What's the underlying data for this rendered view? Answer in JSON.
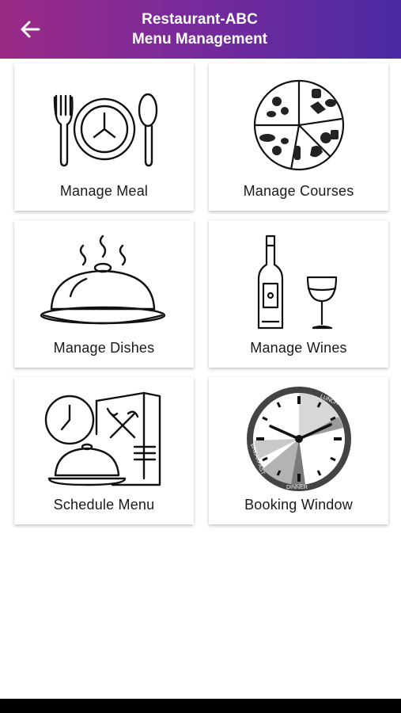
{
  "header": {
    "title_line1": "Restaurant-ABC",
    "title_line2": "Menu Management",
    "back_icon": "arrow-left-icon",
    "gradient_start": "#9b2a86",
    "gradient_end": "#4a2aa4"
  },
  "tiles": [
    {
      "label": "Manage Meal",
      "icon": "meal-plate-icon"
    },
    {
      "label": "Manage Courses",
      "icon": "food-groups-icon"
    },
    {
      "label": "Manage Dishes",
      "icon": "cloche-icon"
    },
    {
      "label": "Manage Wines",
      "icon": "wine-bottle-glass-icon"
    },
    {
      "label": "Schedule Menu",
      "icon": "schedule-menu-icon"
    },
    {
      "label": "Booking Window",
      "icon": "clock-schedule-icon"
    }
  ],
  "clock_labels": {
    "lunch": "LUNCH",
    "breakfast": "BREAKFAST",
    "dinner": "DINNER"
  }
}
